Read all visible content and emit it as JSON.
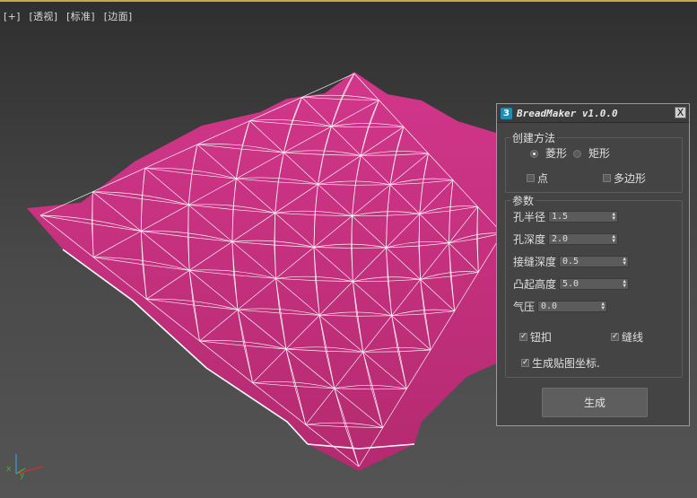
{
  "viewport": {
    "labels": [
      "[+]",
      "[透视]",
      "[标准]",
      "[边面]"
    ],
    "mesh_color": "#c0307a",
    "wire_color": "#ffffff",
    "axis": {
      "x": "x",
      "y": "y"
    }
  },
  "dialog": {
    "logo": "3",
    "title": "BreadMaker v1.0.0",
    "close": "X",
    "create_method": {
      "title": "创建方法",
      "radio_diamond": "菱形",
      "radio_rect": "矩形",
      "check_point": "点",
      "check_polygon": "多边形"
    },
    "params": {
      "title": "参数",
      "hole_radius": {
        "label": "孔半径",
        "value": "1.5"
      },
      "hole_depth": {
        "label": "孔深度",
        "value": "2.0"
      },
      "seam_depth": {
        "label": "接缝深度",
        "value": "0.5"
      },
      "bulge_height": {
        "label": "凸起高度",
        "value": "5.0"
      },
      "pressure": {
        "label": "气压",
        "value": "0.0"
      },
      "button_cb": "钮扣",
      "seam_cb": "缝线",
      "uv_cb": "生成贴图坐标."
    },
    "generate": "生成"
  },
  "colors": {
    "accent": "#1d8fb5",
    "top_line": "#c8a84a"
  }
}
